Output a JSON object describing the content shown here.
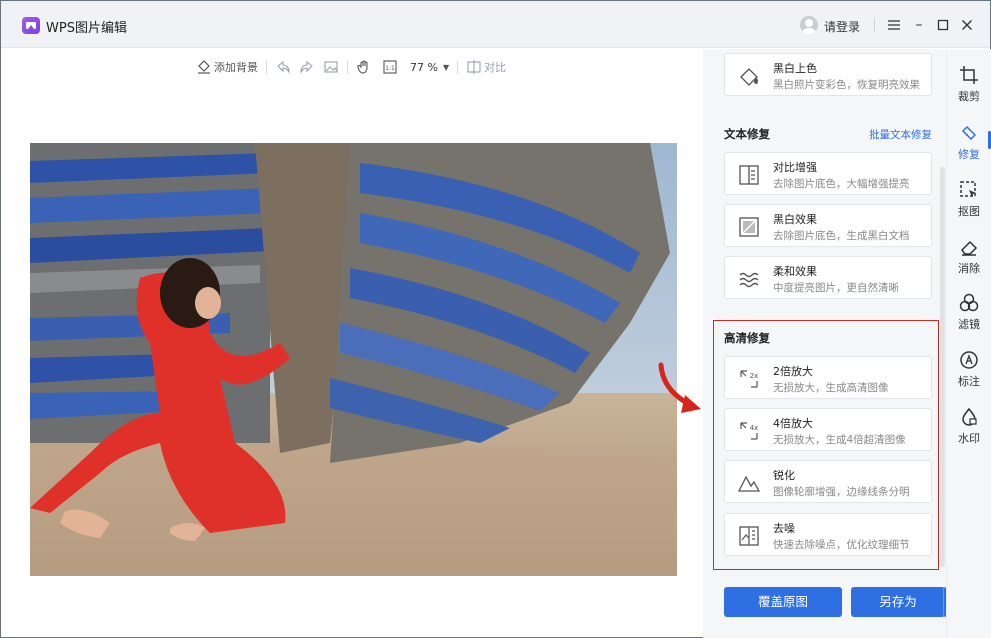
{
  "app": {
    "title": "WPS图片编辑"
  },
  "titlebar": {
    "login_label": "请登录",
    "menu_icon": "menu-icon",
    "minimize": "–",
    "maximize": "☐",
    "close": "✕"
  },
  "toolbar": {
    "add_background": "添加背景",
    "zoom": "77 %",
    "compare": "对比"
  },
  "panel": {
    "top_card": {
      "title": "黑白上色",
      "desc": "黑白照片变彩色，恢复明亮效果"
    },
    "text_section": {
      "title": "文本修复",
      "batch_link": "批量文本修复",
      "cards": [
        {
          "title": "对比增强",
          "desc": "去除图片底色，大幅增强提亮"
        },
        {
          "title": "黑白效果",
          "desc": "去除图片底色，生成黑白文档"
        },
        {
          "title": "柔和效果",
          "desc": "中度提亮图片，更自然清晰"
        }
      ]
    },
    "hd_section": {
      "title": "高清修复",
      "cards": [
        {
          "title": "2倍放大",
          "desc": "无损放大，生成高清图像",
          "icon_text": "2x"
        },
        {
          "title": "4倍放大",
          "desc": "无损放大，生成4倍超清图像",
          "icon_text": "4x"
        },
        {
          "title": "锐化",
          "desc": "图像轮廓增强，边缘线条分明"
        },
        {
          "title": "去噪",
          "desc": "快速去除噪点，优化纹理细节"
        }
      ]
    },
    "buttons": {
      "overwrite": "覆盖原图",
      "save_as": "另存为"
    }
  },
  "rail": [
    {
      "label": "裁剪",
      "icon": "crop-icon"
    },
    {
      "label": "修复",
      "icon": "repair-icon",
      "active": true
    },
    {
      "label": "抠图",
      "icon": "cutout-icon"
    },
    {
      "label": "消除",
      "icon": "eraser-icon"
    },
    {
      "label": "滤镜",
      "icon": "filter-icon"
    },
    {
      "label": "标注",
      "icon": "annotate-icon"
    },
    {
      "label": "水印",
      "icon": "watermark-icon"
    }
  ],
  "colors": {
    "accent": "#2f6fe4",
    "highlight": "#cc2b22",
    "logo": "#8a4ae6"
  }
}
